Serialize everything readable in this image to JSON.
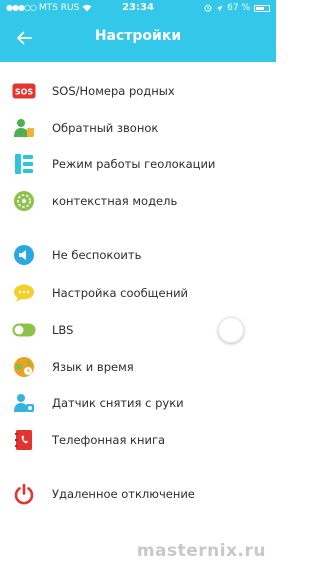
{
  "status_bar": {
    "carrier": "MTS RUS",
    "time": "23:34",
    "battery": "67 %",
    "battery_level": 0.67
  },
  "header": {
    "title": "Настройки"
  },
  "colors": {
    "header": "#33c7ea",
    "sos_red": "#e2352f",
    "callback_green": "#4caf50",
    "geo_cyan": "#2fc5d8",
    "context_green": "#8bc34a",
    "dnd_blue": "#29a9e1",
    "msg_yellow": "#f2d12a",
    "lbs_green": "#8bc34a",
    "lang_orange": "#f0a020",
    "sensor_blue": "#35b3e0",
    "phonebook_red": "#e2352f",
    "power_red": "#e2352f"
  },
  "settings": {
    "items": [
      {
        "label": "SOS/Номера родных",
        "icon": "sos-icon",
        "icon_text": "SOS"
      },
      {
        "label": "Обратный звонок",
        "icon": "person-call-icon"
      },
      {
        "label": "Режим работы геолокации",
        "icon": "geolocation-list-icon"
      },
      {
        "label": "контекстная модель",
        "icon": "context-model-icon"
      },
      {
        "label": "Не беспокоить",
        "icon": "do-not-disturb-icon"
      },
      {
        "label": "Настройка сообщений",
        "icon": "message-chat-icon"
      },
      {
        "label": "LBS",
        "icon": "lbs-toggle-icon",
        "toggle": false
      },
      {
        "label": "Язык и время",
        "icon": "language-time-icon"
      },
      {
        "label": "Датчик снятия с руки",
        "icon": "wrist-sensor-icon"
      },
      {
        "label": "Телефонная книга",
        "icon": "phonebook-icon"
      },
      {
        "label": "Удаленное отключение",
        "icon": "power-icon"
      }
    ]
  },
  "watermark": "masternix.ru"
}
